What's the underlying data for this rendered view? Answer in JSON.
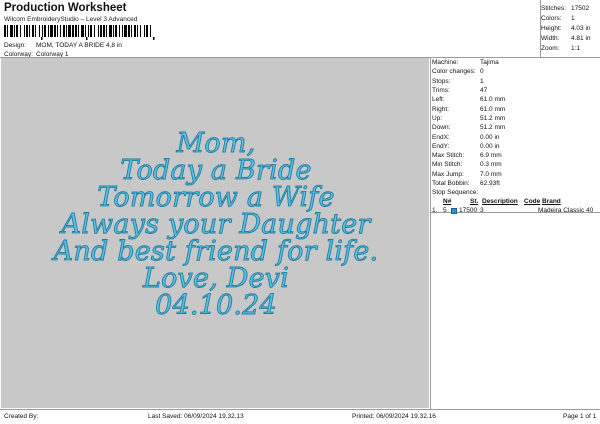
{
  "header": {
    "title": "Production Worksheet",
    "subtitle": "Wilcom EmbroideryStudio – Level 3 Advanced",
    "design_label": "Design:",
    "design_value": "MOM, TODAY A BRIDE 4,8 in",
    "colorway_label": "Colorway:",
    "colorway_value": "Colorway 1"
  },
  "stats": [
    {
      "label": "Stitches:",
      "value": "17502"
    },
    {
      "label": "Colors:",
      "value": "1"
    },
    {
      "label": "Height:",
      "value": "4.03 in"
    },
    {
      "label": "Width:",
      "value": "4.81 in"
    },
    {
      "label": "Zoom:",
      "value": "1:1"
    }
  ],
  "design": {
    "lines": [
      "Mom,",
      "Today a Bride",
      "Tomorrow a Wife",
      "Always your Daughter",
      "And best friend for life.",
      "Love, Devi",
      "04.10.24"
    ],
    "background": "#c8c8c8",
    "thread_color": "#5ec0df",
    "outline_color": "#1f7ea3"
  },
  "machine_info": [
    {
      "label": "Machine:",
      "value": "Tajima"
    },
    {
      "label": "Color changes:",
      "value": "0"
    },
    {
      "label": "Stops:",
      "value": "1"
    },
    {
      "label": "Trims:",
      "value": "47"
    },
    {
      "label": "Left:",
      "value": "61.0 mm"
    },
    {
      "label": "Right:",
      "value": "61.0 mm"
    },
    {
      "label": "Up:",
      "value": "51.2 mm"
    },
    {
      "label": "Down:",
      "value": "51.2 mm"
    },
    {
      "label": "EndX:",
      "value": "0.00 in"
    },
    {
      "label": "EndY:",
      "value": "0.00 in"
    },
    {
      "label": "Max Stitch:",
      "value": "6.9 mm"
    },
    {
      "label": "Min Stitch:",
      "value": "0.3 mm"
    },
    {
      "label": "Max Jump:",
      "value": "7.0 mm"
    },
    {
      "label": "Total Bobbin:",
      "value": "62.93ft"
    }
  ],
  "stop_sequence": {
    "label": "Stop Sequence:",
    "columns": {
      "n": "N#",
      "st": "St.",
      "description": "Description",
      "code": "Code",
      "brand": "Brand"
    },
    "rows": [
      {
        "index": "1.",
        "n": "5",
        "st": "17500",
        "description": "3",
        "code": "",
        "brand": "Madeira Classic 40",
        "swatch": "#2f8fcf"
      }
    ]
  },
  "footer": {
    "created_by": "Created By:",
    "last_saved": "Last Saved: 06/09/2024 19.32.13",
    "printed": "Printed: 06/09/2024 19.32.16",
    "page": "Page 1 of 1"
  }
}
